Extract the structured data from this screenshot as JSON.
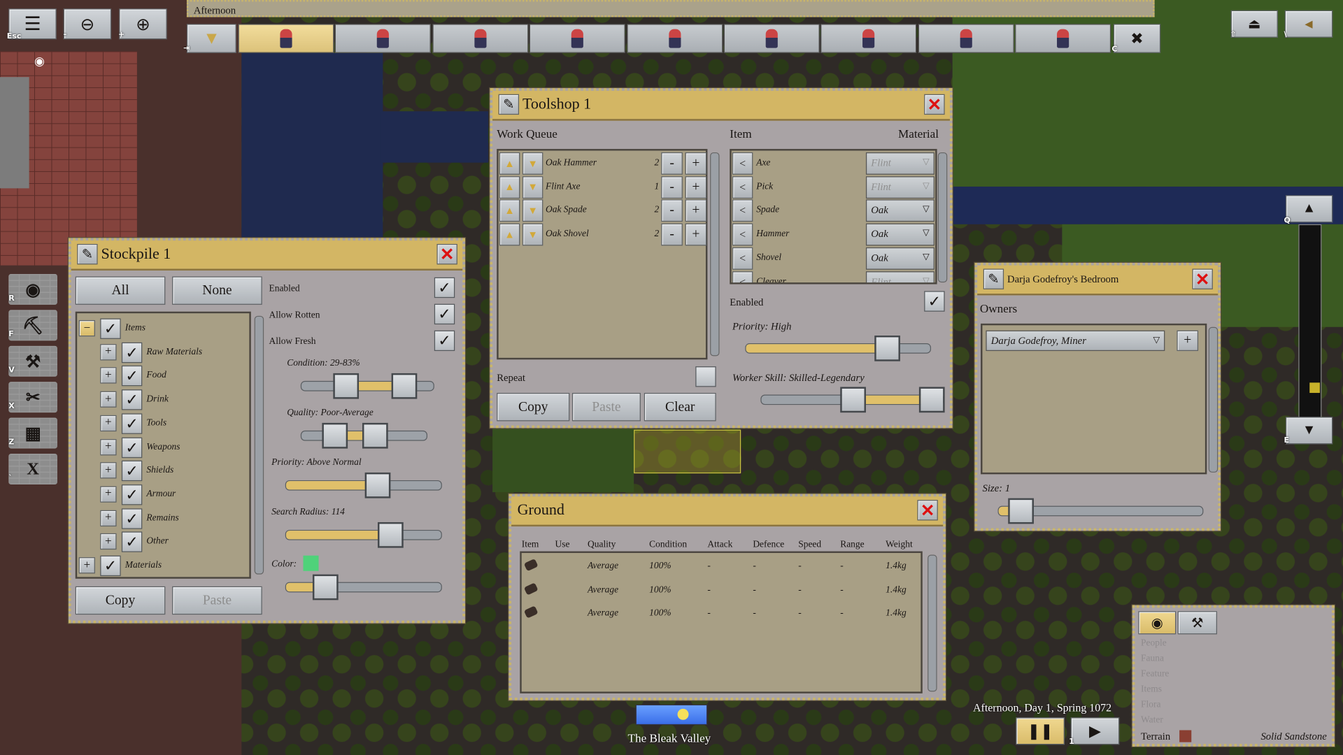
{
  "status_bar": {
    "text": "Afternoon"
  },
  "top_left": {
    "menu": {
      "icon": "menu-icon",
      "key": "Esc"
    },
    "zoom_out": {
      "icon": "zoom-out-icon",
      "key": "-"
    },
    "zoom_in": {
      "icon": "zoom-in-icon",
      "key": "+"
    }
  },
  "profession_toolbar": {
    "collapse_key": "⇥",
    "tabs": [
      {
        "icon": "miner-dwarf-icon",
        "active": true
      },
      {
        "icon": "scholar-dwarf-icon",
        "active": false
      },
      {
        "icon": "lantern-dwarf-icon",
        "active": false
      },
      {
        "icon": "woodcutter-dwarf-icon",
        "active": false
      },
      {
        "icon": "smith-dwarf-icon",
        "active": false
      },
      {
        "icon": "warrior-dwarf-icon",
        "active": false
      },
      {
        "icon": "farmer-dwarf-icon",
        "active": false
      },
      {
        "icon": "carpenter-dwarf-icon",
        "active": false
      },
      {
        "icon": "hunter-dwarf-icon",
        "active": false
      }
    ],
    "gather_key": "C"
  },
  "top_right": {
    "view_key": "⇧",
    "options_key": "\\"
  },
  "z_level": {
    "up_key": "Q",
    "down_key": "E",
    "level": 0.86
  },
  "left_tools": [
    {
      "icon": "eye-icon",
      "key": "R",
      "glyph": "◉"
    },
    {
      "icon": "pickaxe-icon",
      "key": "F",
      "glyph": "⛏"
    },
    {
      "icon": "hammer-icon",
      "key": "V",
      "glyph": "⚒"
    },
    {
      "icon": "cut-tree-icon",
      "key": "X",
      "glyph": "✂"
    },
    {
      "icon": "stockpile-icon",
      "key": "Z",
      "glyph": "▦"
    },
    {
      "icon": "cancel-icon",
      "key": "`",
      "glyph": "X"
    }
  ],
  "stockpile": {
    "title": "Stockpile 1",
    "all_label": "All",
    "none_label": "None",
    "options": [
      {
        "label": "Enabled",
        "checked": true
      },
      {
        "label": "Allow Rotten",
        "checked": true
      },
      {
        "label": "Allow Fresh",
        "checked": true
      }
    ],
    "tree": [
      {
        "label": "Items",
        "expanded": true,
        "level": 0,
        "checked": true
      },
      {
        "label": "Raw Materials",
        "expanded": false,
        "level": 1,
        "checked": true
      },
      {
        "label": "Food",
        "expanded": false,
        "level": 1,
        "checked": true
      },
      {
        "label": "Drink",
        "expanded": false,
        "level": 1,
        "checked": true
      },
      {
        "label": "Tools",
        "expanded": false,
        "level": 1,
        "checked": true
      },
      {
        "label": "Weapons",
        "expanded": false,
        "level": 1,
        "checked": true
      },
      {
        "label": "Shields",
        "expanded": false,
        "level": 1,
        "checked": true
      },
      {
        "label": "Armour",
        "expanded": false,
        "level": 1,
        "checked": true
      },
      {
        "label": "Remains",
        "expanded": false,
        "level": 1,
        "checked": true
      },
      {
        "label": "Other",
        "expanded": false,
        "level": 1,
        "checked": true
      },
      {
        "label": "Materials",
        "expanded": false,
        "level": 0,
        "checked": true
      }
    ],
    "condition": {
      "label": "Condition:",
      "value": "29-83%",
      "range": [
        0.29,
        0.83
      ]
    },
    "quality": {
      "label": "Quality:",
      "value": "Poor-Average",
      "range": [
        0.2,
        0.6
      ]
    },
    "priority": {
      "label": "Priority:",
      "value": "Above Normal",
      "level": 0.6
    },
    "search_radius": {
      "label": "Search Radius:",
      "value": "114",
      "level": 0.7
    },
    "color": {
      "label": "Color:",
      "swatch": "#4fd27a",
      "level": 0.2
    },
    "copy_label": "Copy",
    "paste_label": "Paste"
  },
  "toolshop": {
    "title": "Toolshop 1",
    "work_queue_label": "Work Queue",
    "item_label": "Item",
    "material_label": "Material",
    "queue": [
      {
        "name": "Oak Hammer",
        "count": "2"
      },
      {
        "name": "Flint Axe",
        "count": "1"
      },
      {
        "name": "Oak Spade",
        "count": "2"
      },
      {
        "name": "Oak Shovel",
        "count": "2"
      }
    ],
    "items": [
      {
        "name": "Axe",
        "material": "Flint",
        "enabled": false
      },
      {
        "name": "Pick",
        "material": "Flint",
        "enabled": false
      },
      {
        "name": "Spade",
        "material": "Oak",
        "enabled": true
      },
      {
        "name": "Hammer",
        "material": "Oak",
        "enabled": true
      },
      {
        "name": "Shovel",
        "material": "Oak",
        "enabled": true
      },
      {
        "name": "Cleaver",
        "material": "Flint",
        "enabled": false
      }
    ],
    "repeat_label": "Repeat",
    "repeat_checked": false,
    "enabled_label": "Enabled",
    "enabled_checked": true,
    "priority_label": "Priority:",
    "priority_value": "High",
    "priority_level": 0.8,
    "worker_skill_label": "Worker Skill:",
    "worker_skill_value": "Skilled-Legendary",
    "worker_skill_range": [
      0.5,
      1.0
    ],
    "copy_label": "Copy",
    "paste_label": "Paste",
    "clear_label": "Clear"
  },
  "bedroom": {
    "title": "Darja Godefroy's Bedroom",
    "owners_label": "Owners",
    "owner": "Darja Godefroy, Miner",
    "size_label": "Size:",
    "size_value": "1",
    "size_level": 0.05
  },
  "ground": {
    "title": "Ground",
    "columns": [
      "Item",
      "Use",
      "Quality",
      "Condition",
      "Attack",
      "Defence",
      "Speed",
      "Range",
      "Weight"
    ],
    "rows": [
      {
        "icon": "log-icon",
        "use": "",
        "quality": "Average",
        "condition": "100%",
        "attack": "-",
        "defence": "-",
        "speed": "-",
        "range": "-",
        "weight": "1.4kg"
      },
      {
        "icon": "log-icon",
        "use": "",
        "quality": "Average",
        "condition": "100%",
        "attack": "-",
        "defence": "-",
        "speed": "-",
        "range": "-",
        "weight": "1.4kg"
      },
      {
        "icon": "log-icon",
        "use": "",
        "quality": "Average",
        "condition": "100%",
        "attack": "-",
        "defence": "-",
        "speed": "-",
        "range": "-",
        "weight": "1.4kg"
      }
    ]
  },
  "info_panel": {
    "tabs": [
      {
        "icon": "eye-icon",
        "active": true
      },
      {
        "icon": "tools-icon",
        "active": false
      }
    ],
    "categories": [
      "People",
      "Fauna",
      "Feature",
      "Items",
      "Flora",
      "Water"
    ],
    "terrain_label": "Terrain",
    "terrain_value": "Solid Sandstone",
    "terrain_color": "#8a3f32"
  },
  "time": {
    "text": "Afternoon, Day 1, Spring 1072",
    "pause_key": "",
    "play_key": "1"
  },
  "location": {
    "name": "The Bleak Valley"
  },
  "colors": {
    "panel": "#a9a3a5",
    "header": "#d3b664",
    "list": "#a89f85",
    "accent_gold": "#e0c06a"
  }
}
